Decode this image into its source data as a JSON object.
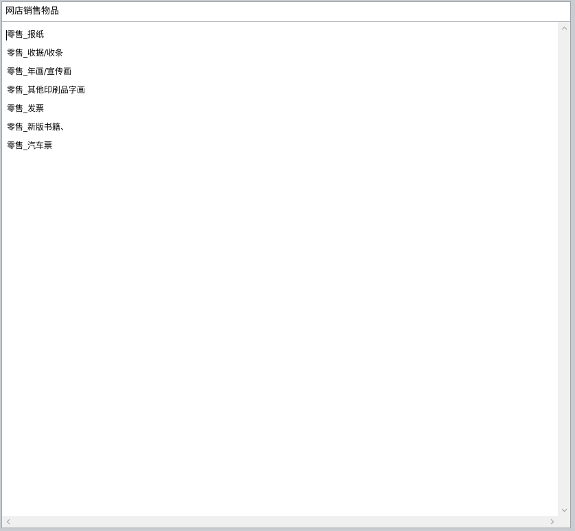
{
  "window": {
    "title": "网店销售物品"
  },
  "editor": {
    "lines": [
      "零售_报纸",
      "零售_收据/收条",
      "零售_年画/宣传画",
      "零售_其他印刷品字画",
      "零售_发票",
      "零售_新版书籍、",
      "零售_汽车票"
    ]
  },
  "scrollbars": {
    "vertical": {
      "up_icon": "chevron-up-icon",
      "down_icon": "chevron-down-icon"
    },
    "horizontal": {
      "left_icon": "chevron-left-icon",
      "right_icon": "chevron-right-icon"
    }
  },
  "colors": {
    "frame": "#c9cdd2",
    "track": "#f0f0f0",
    "arrow": "#a6a6a6",
    "text": "#000000"
  }
}
